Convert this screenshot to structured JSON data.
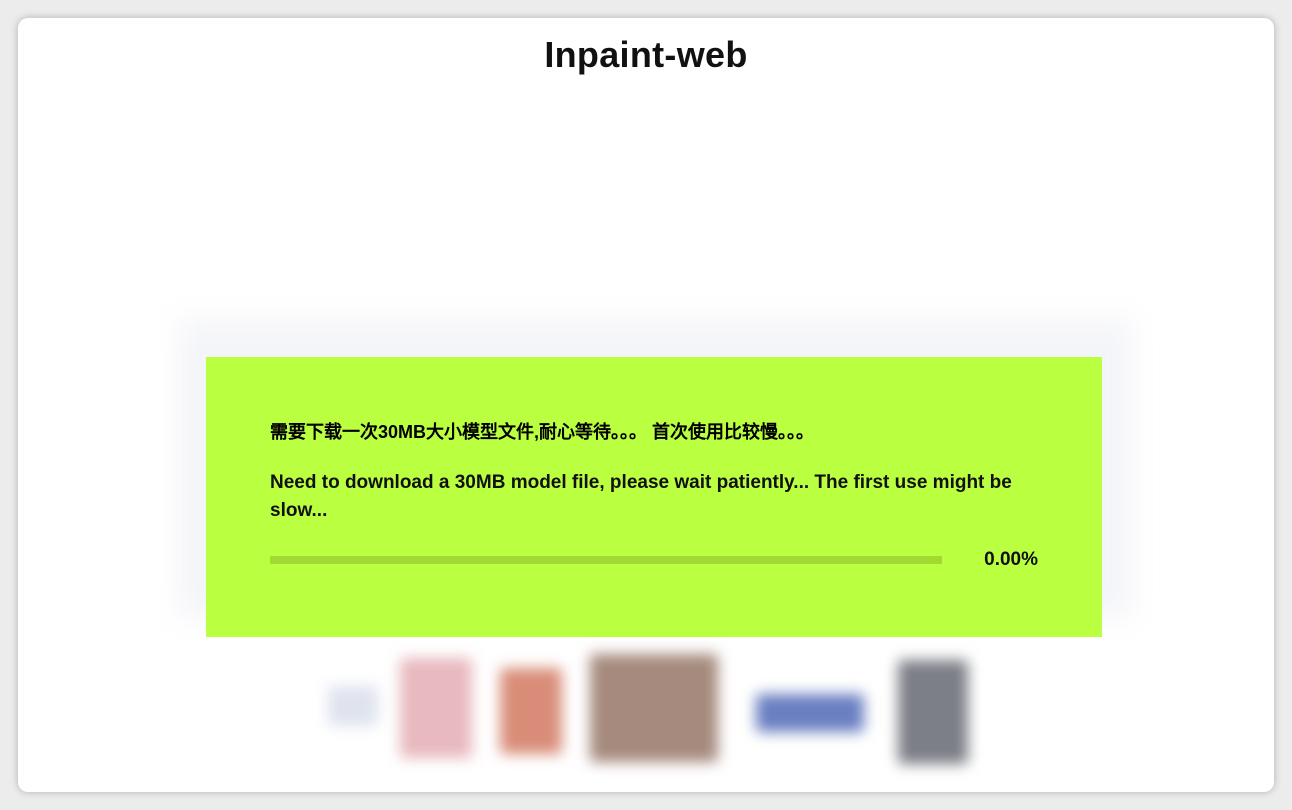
{
  "app": {
    "title": "Inpaint-web"
  },
  "loading_dialog": {
    "message_zh": "需要下载一次30MB大小模型文件,耐心等待。。。 首次使用比较慢。。。",
    "message_en": "Need to download a 30MB model file, please wait patiently... The first use might be slow...",
    "progress_value": 0.0,
    "progress_text": "0.00%"
  },
  "colors": {
    "accent": "#bbff41",
    "progress_track": "#a3d933",
    "progress_fill": "#6e9a12",
    "window_bg": "#ffffff"
  },
  "examples": {
    "items": [
      {
        "name": "example-thumb-1",
        "color": "#dfe3ee"
      },
      {
        "name": "example-thumb-2",
        "color": "#e8b9bf"
      },
      {
        "name": "example-thumb-3",
        "color": "#d98d78"
      },
      {
        "name": "example-thumb-4",
        "color": "#a58a7d"
      },
      {
        "name": "example-thumb-5",
        "color": "#6a7fc2"
      },
      {
        "name": "example-thumb-6",
        "color": "#7c7f86"
      }
    ]
  }
}
